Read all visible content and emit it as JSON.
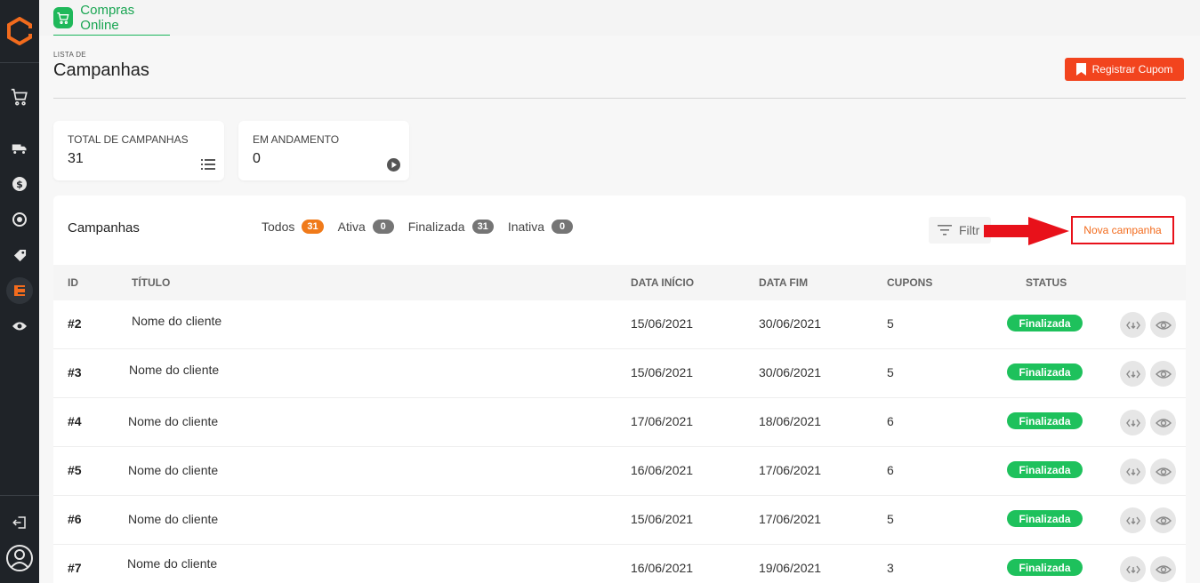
{
  "sidebar": {
    "logo": "brand-logo",
    "icons": [
      "cart-icon",
      "truck-icon",
      "dollar-coin-icon",
      "exchange-icon",
      "tag-icon",
      "campaign-icon",
      "eye-icon"
    ],
    "bottom_icons": [
      "logout-icon",
      "user-avatar-icon"
    ]
  },
  "topbar": {
    "tab_label": "Compras Online"
  },
  "header": {
    "breadcrumb": "LISTA DE",
    "title": "Campanhas",
    "register_button": "Registrar Cupom"
  },
  "stats": [
    {
      "label": "TOTAL DE CAMPANHAS",
      "value": "31"
    },
    {
      "label": "EM ANDAMENTO",
      "value": "0"
    }
  ],
  "campaigns_card": {
    "title": "Campanhas",
    "filters": [
      {
        "label": "Todos",
        "count": "31"
      },
      {
        "label": "Ativa",
        "count": "0"
      },
      {
        "label": "Finalizada",
        "count": "31"
      },
      {
        "label": "Inativa",
        "count": "0"
      }
    ],
    "filter_button": "Filtr",
    "new_campaign": "Nova campanha"
  },
  "table": {
    "columns": [
      "ID",
      "TÍTULO",
      "DATA INÍCIO",
      "DATA FIM",
      "CUPONS",
      "STATUS"
    ],
    "rows": [
      {
        "id": "#2",
        "title": "Nome do cliente",
        "start": "15/06/2021",
        "end": "30/06/2021",
        "coupons": "5",
        "status": "Finalizada"
      },
      {
        "id": "#3",
        "title": "Nome do cliente",
        "start": "15/06/2021",
        "end": "30/06/2021",
        "coupons": "5",
        "status": "Finalizada"
      },
      {
        "id": "#4",
        "title": "Nome do cliente",
        "start": "17/06/2021",
        "end": "18/06/2021",
        "coupons": "6",
        "status": "Finalizada"
      },
      {
        "id": "#5",
        "title": "Nome do cliente",
        "start": "16/06/2021",
        "end": "17/06/2021",
        "coupons": "6",
        "status": "Finalizada"
      },
      {
        "id": "#6",
        "title": "Nome do cliente",
        "start": "15/06/2021",
        "end": "17/06/2021",
        "coupons": "5",
        "status": "Finalizada"
      },
      {
        "id": "#7",
        "title": "Nome do cliente",
        "start": "16/06/2021",
        "end": "19/06/2021",
        "coupons": "3",
        "status": "Finalizada"
      }
    ]
  },
  "colors": {
    "accent_orange": "#f2441e",
    "status_green": "#1ec15c",
    "annotation_red": "#e8111a",
    "tab_green": "#19a552"
  }
}
